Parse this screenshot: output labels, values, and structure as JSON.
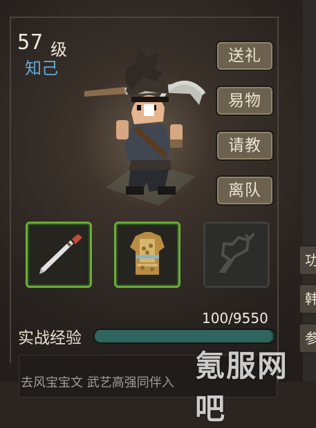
{
  "character": {
    "level": "57",
    "level_unit": "级",
    "relation": "知己"
  },
  "actions": [
    {
      "label": "送礼"
    },
    {
      "label": "易物"
    },
    {
      "label": "请教"
    },
    {
      "label": "离队"
    }
  ],
  "equipment": [
    {
      "name": "blade-icon"
    },
    {
      "name": "armor-icon"
    },
    {
      "name": "empty-accessory-icon"
    }
  ],
  "experience": {
    "label": "实战经验",
    "value": "100/9550",
    "progress": 0.99
  },
  "bottom_text": "去风宝宝文 武艺高强同伴入",
  "right_tabs": [
    "功",
    "韩",
    "参"
  ],
  "watermark": "氪服网吧"
}
